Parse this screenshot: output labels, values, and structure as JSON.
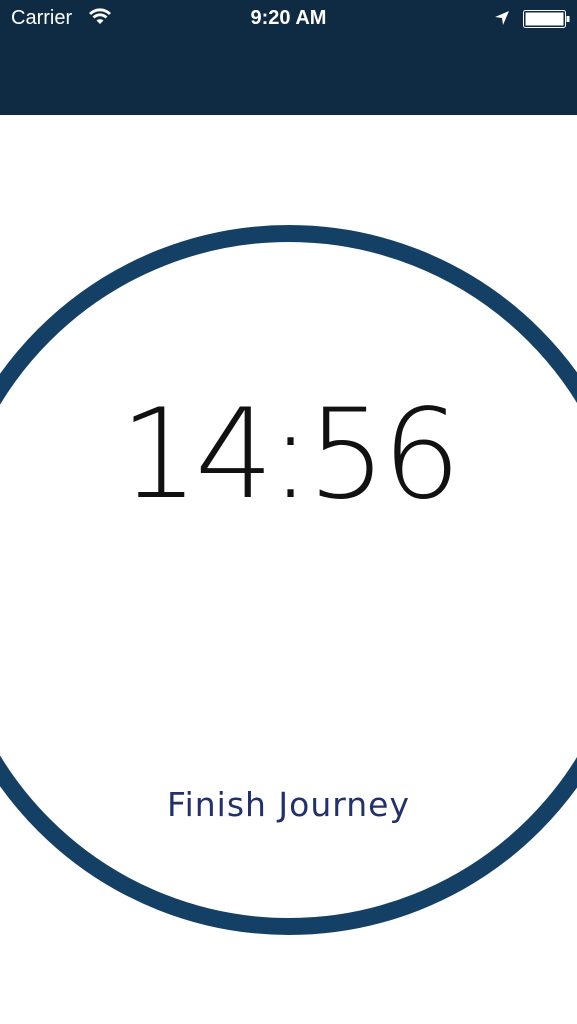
{
  "status_bar": {
    "carrier": "Carrier",
    "time": "9:20 AM",
    "wifi_icon": "wifi-icon",
    "location_icon": "location-arrow-icon",
    "battery_icon": "battery-icon"
  },
  "colors": {
    "nav_background": "#0f2a43",
    "ring": "#154066",
    "timer_text": "#111111",
    "finish_text": "#22306b"
  },
  "timer": {
    "display": "14:56"
  },
  "actions": {
    "finish_label": "Finish Journey"
  }
}
